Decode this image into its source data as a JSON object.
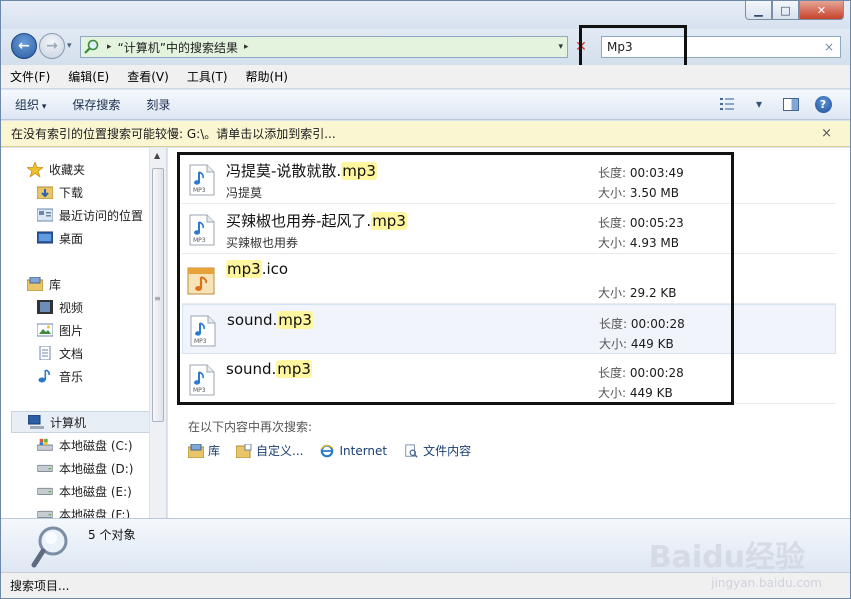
{
  "window": {
    "min_label": "▁",
    "max_label": "□",
    "close_label": "✕"
  },
  "address": {
    "path_label": "“计算机”中的搜索结果",
    "arrow": "▸"
  },
  "search": {
    "value": "Mp3",
    "clear": "×"
  },
  "menu": [
    "文件(F)",
    "编辑(E)",
    "查看(V)",
    "工具(T)",
    "帮助(H)"
  ],
  "toolbar": {
    "organize": "组织",
    "save_search": "保存搜索",
    "burn": "刻录"
  },
  "infobar": {
    "text": "在没有索引的位置搜索可能较慢: G:\\。请单击以添加到索引...",
    "close": "×"
  },
  "nav": {
    "favorites": "收藏夹",
    "downloads": "下载",
    "recent": "最近访问的位置",
    "desktop": "桌面",
    "libraries": "库",
    "videos": "视频",
    "pictures": "图片",
    "documents": "文档",
    "music": "音乐",
    "computer": "计算机",
    "disk_c": "本地磁盘 (C:)",
    "disk_d": "本地磁盘 (D:)",
    "disk_e": "本地磁盘 (E:)",
    "disk_f": "本地磁盘 (F:)"
  },
  "files": [
    {
      "name_prefix": "冯提莫-说散就散.",
      "name_match": "mp3",
      "name_suffix": "",
      "sub": "冯提莫",
      "length_label": "长度:",
      "length": "00:03:49",
      "size_label": "大小:",
      "size": "3.50 MB",
      "icon": "audio-file-icon"
    },
    {
      "name_prefix": "买辣椒也用券-起风了.",
      "name_match": "mp3",
      "name_suffix": "",
      "sub": "买辣椒也用券",
      "length_label": "长度:",
      "length": "00:05:23",
      "size_label": "大小:",
      "size": "4.93 MB",
      "icon": "audio-file-icon"
    },
    {
      "name_prefix": "",
      "name_match": "mp3",
      "name_suffix": ".ico",
      "sub": "",
      "length_label": "",
      "length": "",
      "size_label": "大小:",
      "size": "29.2 KB",
      "icon": "ico-file-icon"
    },
    {
      "name_prefix": "sound.",
      "name_match": "mp3",
      "name_suffix": "",
      "sub": "",
      "length_label": "长度:",
      "length": "00:00:28",
      "size_label": "大小:",
      "size": "449 KB",
      "icon": "audio-file-icon"
    },
    {
      "name_prefix": "sound.",
      "name_match": "mp3",
      "name_suffix": "",
      "sub": "",
      "length_label": "长度:",
      "length": "00:00:28",
      "size_label": "大小:",
      "size": "449 KB",
      "icon": "audio-file-icon"
    }
  ],
  "search_again": {
    "heading": "在以下内容中再次搜索:",
    "libraries": "库",
    "custom": "自定义...",
    "internet": "Internet",
    "file_contents": "文件内容"
  },
  "details": {
    "count": "5 个对象"
  },
  "status": {
    "text": "搜索项目..."
  },
  "watermark": {
    "text": "Baidu经验",
    "sub": "jingyan.baidu.com"
  },
  "colors": {
    "match_highlight": "#fff6a0",
    "info_bar": "#fbf6d2"
  }
}
